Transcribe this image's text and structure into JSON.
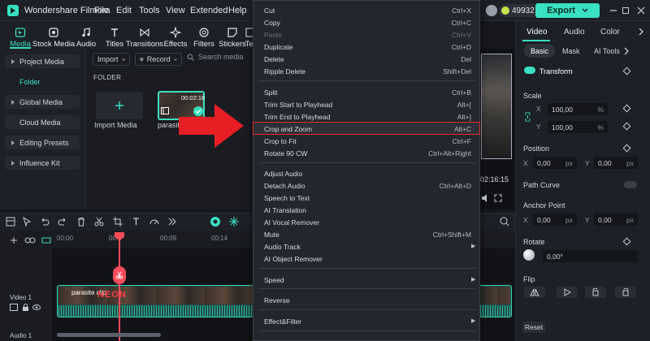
{
  "titlebar": {
    "app_title": "Wondershare Filmora",
    "menus": [
      "File",
      "Edit",
      "Tools",
      "View",
      "Extended",
      "Help"
    ],
    "credits": "49932",
    "export_label": "Export"
  },
  "toolbar": {
    "items": [
      "Media",
      "Stock Media",
      "Audio",
      "Titles",
      "Transitions",
      "Effects",
      "Filters",
      "Stickers",
      "Te"
    ]
  },
  "sidebar": {
    "items": [
      "Project Media",
      "Folder",
      "Global Media",
      "Cloud Media",
      "Editing Presets",
      "Influence Kit"
    ]
  },
  "media": {
    "import_label": "Import",
    "record_label": "Record",
    "search_placeholder": "Search media",
    "folder_label": "FOLDER",
    "import_media_label": "Import Media",
    "clip_name": "parasit",
    "clip_duration": "00:02:16"
  },
  "preview": {
    "time": "02:16:15"
  },
  "timeline": {
    "ruler": [
      "00:00",
      "00:0",
      "00:09",
      "00:14"
    ],
    "clip_label": "parasite clip",
    "overlay_text": "NEON",
    "video_track_label": "Video 1",
    "audio_track_label": "Audio 1"
  },
  "context_menu": {
    "items": [
      {
        "label": "Cut",
        "shortcut": "Ctrl+X"
      },
      {
        "label": "Copy",
        "shortcut": "Ctrl+C"
      },
      {
        "label": "Paste",
        "shortcut": "Ctrl+V",
        "disabled": true
      },
      {
        "label": "Duplicate",
        "shortcut": "Ctrl+D"
      },
      {
        "label": "Delete",
        "shortcut": "Del"
      },
      {
        "label": "Ripple Delete",
        "shortcut": "Shift+Del"
      },
      {
        "label": "Split",
        "shortcut": "Ctrl+B"
      },
      {
        "label": "Trim Start to Playhead",
        "shortcut": "Alt+["
      },
      {
        "label": "Trim End to Playhead",
        "shortcut": "Alt+]"
      },
      {
        "label": "Crop and Zoom",
        "shortcut": "Alt+C"
      },
      {
        "label": "Crop to Fit",
        "shortcut": "Ctrl+F"
      },
      {
        "label": "Rotate 90 CW",
        "shortcut": "Ctrl+Alt+Right"
      },
      {
        "label": "Adjust Audio",
        "shortcut": ""
      },
      {
        "label": "Detach Audio",
        "shortcut": "Ctrl+Alt+D"
      },
      {
        "label": "Speech to Text",
        "shortcut": ""
      },
      {
        "label": "AI Translation",
        "shortcut": ""
      },
      {
        "label": "AI Vocal Remover",
        "shortcut": ""
      },
      {
        "label": "Mute",
        "shortcut": "Ctrl+Shift+M"
      },
      {
        "label": "Audio Track",
        "shortcut": ""
      },
      {
        "label": "AI Object Remover",
        "shortcut": ""
      },
      {
        "label": "Speed",
        "shortcut": ""
      },
      {
        "label": "Reverse",
        "shortcut": ""
      },
      {
        "label": "Effect&Filter",
        "shortcut": ""
      }
    ]
  },
  "right_panel": {
    "tabs": [
      "Video",
      "Audio",
      "Color"
    ],
    "subtabs": [
      "Basic",
      "Mask",
      "AI Tools"
    ],
    "transform": "Transform",
    "scale": {
      "title": "Scale",
      "x": "100,00",
      "y": "100,00",
      "unit": "%"
    },
    "position": {
      "title": "Position",
      "x": "0,00",
      "y": "0,00",
      "unit": "px"
    },
    "path_curve": "Path Curve",
    "anchor_point": {
      "title": "Anchor Point",
      "x": "0,00",
      "y": "0,00",
      "unit": "px"
    },
    "rotate": {
      "title": "Rotate",
      "value": "0,00°"
    },
    "flip": "Flip",
    "reset_label": "Reset",
    "axis_x": "X",
    "axis_y": "Y"
  },
  "colors": {
    "accent": "#39e0c2",
    "highlight": "#e52c2c",
    "arrow": "#e81e25"
  }
}
